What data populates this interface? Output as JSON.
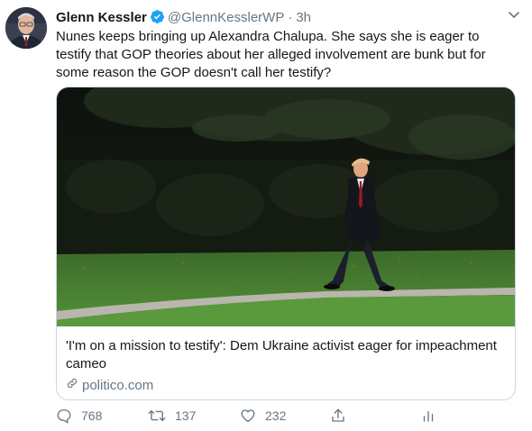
{
  "author": {
    "name": "Glenn Kessler",
    "handle": "@GlennKesslerWP",
    "separator": "·",
    "time": "3h"
  },
  "tweet_text": "Nunes keeps bringing up Alexandra Chalupa. She says she is eager to testify that GOP theories about her alleged involvement are bunk but for some reason the GOP doesn't call her testify?",
  "card": {
    "title": "'I'm on a mission to testify': Dem Ukraine activist eager for impeachment cameo",
    "domain": "politico.com"
  },
  "actions": {
    "replies": "768",
    "retweets": "137",
    "likes": "232"
  },
  "colors": {
    "text": "#14171a",
    "secondary": "#657786",
    "verified": "#1da1f2",
    "border": "#ccd6dd"
  },
  "icons": [
    "verified-badge-icon",
    "chevron-down-icon",
    "link-icon",
    "reply-icon",
    "retweet-icon",
    "like-icon",
    "share-icon",
    "analytics-icon"
  ]
}
